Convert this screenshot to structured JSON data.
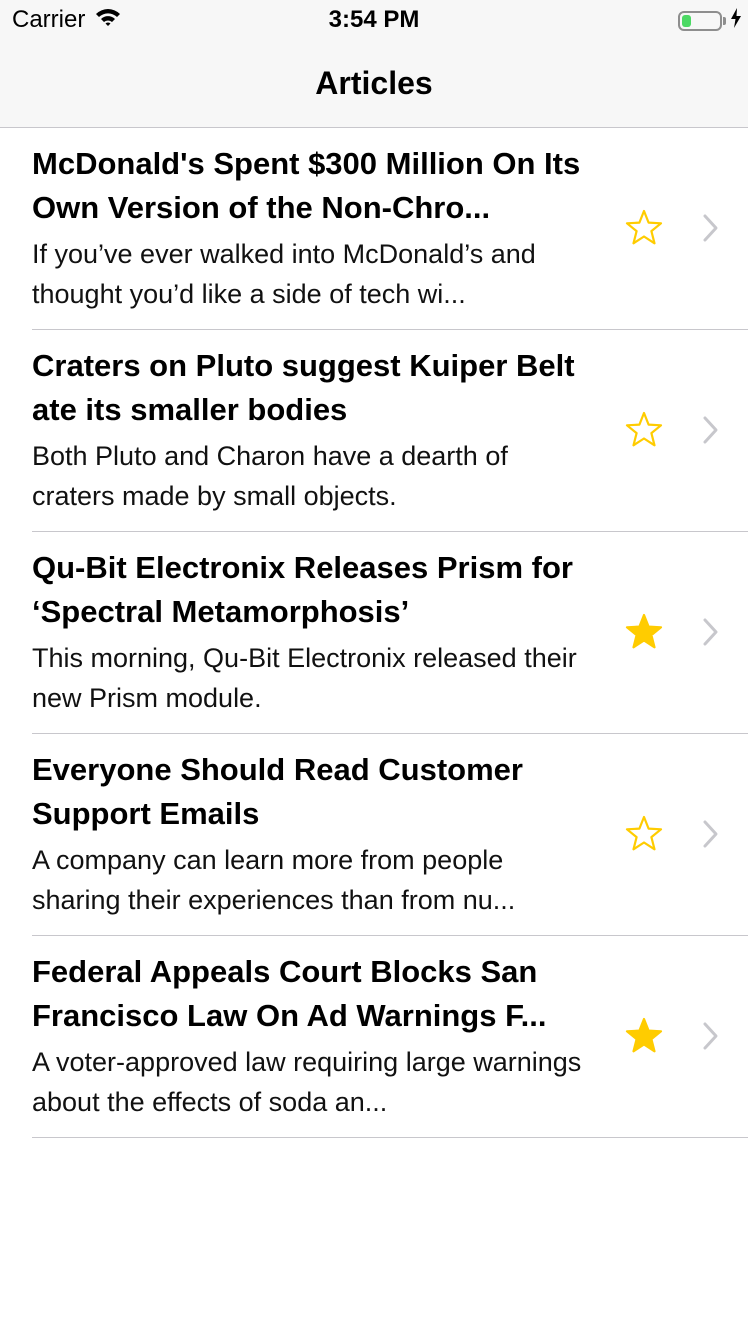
{
  "status_bar": {
    "carrier": "Carrier",
    "time": "3:54 PM",
    "battery_level": 0.25,
    "battery_color": "#4cd964"
  },
  "nav": {
    "title": "Articles"
  },
  "colors": {
    "star": "#ffcc00",
    "chevron": "#c7c7cc",
    "separator": "#c8c7cc"
  },
  "articles": [
    {
      "title": "McDonald's Spent $300 Million On Its Own Version of the Non-Chro...",
      "summary": "If you’ve ever walked into McDonald’s and thought you’d like a side of tech wi...",
      "starred": false
    },
    {
      "title": "Craters on Pluto suggest Kuiper Belt ate its smaller bodies",
      "summary": "Both Pluto and Charon have a dearth of craters made by small objects.",
      "starred": false
    },
    {
      "title": "Qu-Bit Electronix Releases Prism for ‘Spectral Metamorphosis’",
      "summary": "This morning, Qu-Bit Electronix released their new Prism module.",
      "starred": true
    },
    {
      "title": "Everyone Should Read Customer Support Emails",
      "summary": "A company can learn more from people sharing their experiences than from nu...",
      "starred": false
    },
    {
      "title": "Federal Appeals Court Blocks San Francisco Law On Ad Warnings F...",
      "summary": "A voter-approved law requiring large warnings about the effects of soda an...",
      "starred": true
    }
  ]
}
